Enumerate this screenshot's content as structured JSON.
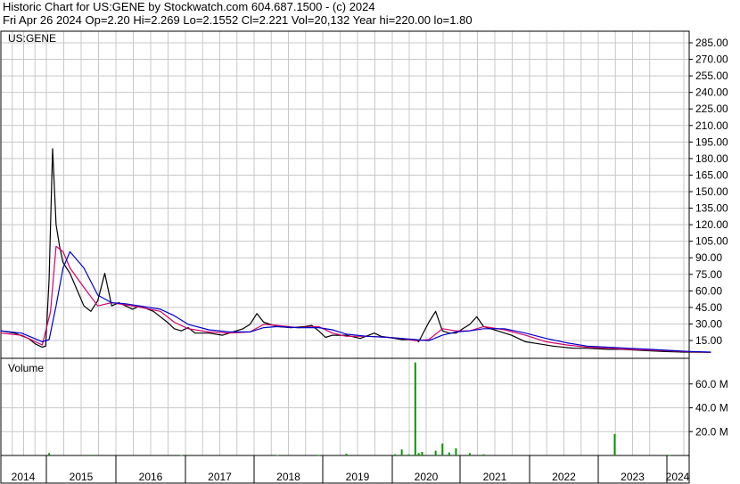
{
  "header": {
    "title": "Historic Chart for US:GENE by Stockwatch.com 604.687.1500 - (c) 2024",
    "quote": "Fri Apr 26 2024   Op=2.20   Hi=2.269   Lo=2.1552   Cl=2.221   Vol=20,132   Year hi=220.00   lo=1.80"
  },
  "chart_data": {
    "type": "line",
    "symbol_label": "US:GENE",
    "volume_label": "Volume",
    "years": [
      "2014",
      "2015",
      "2016",
      "2017",
      "2018",
      "2019",
      "2020",
      "2021",
      "2022",
      "2023",
      "2024"
    ],
    "price_ticks": [
      "285.00",
      "270.00",
      "255.00",
      "240.00",
      "225.00",
      "210.00",
      "195.00",
      "180.00",
      "165.00",
      "150.00",
      "135.00",
      "120.00",
      "105.00",
      "90.00",
      "75.00",
      "60.00",
      "45.00",
      "30.00",
      "15.00"
    ],
    "volume_ticks": [
      "60.0 M",
      "40.0 M",
      "20.0 M"
    ],
    "price_ylim": [
      0,
      295
    ],
    "volume_ylim": [
      0,
      80
    ],
    "colors": {
      "price": "#000000",
      "ma_short": "#d4006a",
      "ma_long": "#0000cc",
      "volume": "#009900",
      "grid": "#c8c8c8"
    },
    "series": [
      {
        "x": [
          2014.0,
          2014.2,
          2014.4,
          2014.5,
          2014.6,
          2014.65,
          2014.7,
          2014.72,
          2014.75,
          2014.8,
          2014.85,
          2014.9,
          2015.0,
          2015.1,
          2015.2,
          2015.3,
          2015.4,
          2015.5,
          2015.6,
          2015.7,
          2015.8,
          2015.9,
          2016.0,
          2016.2,
          2016.4,
          2016.5,
          2016.6,
          2016.7,
          2016.8,
          2017.0,
          2017.2,
          2017.4,
          2017.5,
          2017.6,
          2017.7,
          2017.8,
          2018.0,
          2018.2,
          2018.4,
          2018.5,
          2018.6,
          2018.7,
          2018.8,
          2019.0,
          2019.2,
          2019.4,
          2019.5,
          2019.6,
          2019.7,
          2019.8,
          2020.0,
          2020.05,
          2020.1,
          2020.2,
          2020.3,
          2020.4,
          2020.5,
          2020.6,
          2020.7,
          2020.8,
          2020.9,
          2021.0,
          2021.2,
          2021.4,
          2021.6,
          2021.8,
          2022.0,
          2022.3,
          2022.5,
          2022.8,
          2023.0,
          2023.3,
          2023.6,
          2023.9,
          2024.1,
          2024.3
        ],
        "y": [
          22,
          20,
          15,
          10,
          7,
          8,
          70,
          120,
          190,
          120,
          100,
          85,
          75,
          60,
          45,
          40,
          50,
          75,
          45,
          48,
          45,
          42,
          45,
          40,
          30,
          24,
          22,
          25,
          20,
          20,
          18,
          22,
          24,
          28,
          38,
          30,
          26,
          25,
          26,
          27,
          22,
          16,
          18,
          18,
          15,
          20,
          17,
          16,
          15,
          14,
          14,
          12,
          18,
          30,
          40,
          22,
          20,
          20,
          24,
          28,
          35,
          26,
          22,
          18,
          12,
          10,
          8,
          6,
          6,
          5,
          5,
          4,
          3,
          2.5,
          2.3,
          2.2
        ],
        "name": ""
      },
      {
        "x": [
          2014.0,
          2014.3,
          2014.6,
          2014.72,
          2014.8,
          2014.9,
          2015.0,
          2015.2,
          2015.4,
          2015.6,
          2015.8,
          2016.0,
          2016.3,
          2016.5,
          2016.7,
          2017.0,
          2017.3,
          2017.6,
          2017.8,
          2018.0,
          2018.3,
          2018.6,
          2018.8,
          2019.0,
          2019.3,
          2019.6,
          2019.8,
          2020.0,
          2020.2,
          2020.4,
          2020.6,
          2020.8,
          2021.0,
          2021.3,
          2021.6,
          2021.9,
          2022.2,
          2022.5,
          2022.8,
          2023.1,
          2023.4,
          2023.7,
          2024.0,
          2024.3
        ],
        "y": [
          20,
          18,
          9,
          40,
          100,
          95,
          80,
          62,
          45,
          48,
          46,
          44,
          40,
          30,
          24,
          21,
          20,
          21,
          28,
          27,
          25,
          26,
          20,
          17,
          17,
          16,
          15,
          13,
          14,
          24,
          22,
          22,
          26,
          23,
          18,
          12,
          9,
          7,
          6,
          5,
          4.3,
          3.5,
          2.8,
          2.3
        ],
        "name": ""
      },
      {
        "x": [
          2014.0,
          2014.3,
          2014.6,
          2014.7,
          2014.8,
          2014.9,
          2015.0,
          2015.2,
          2015.4,
          2015.6,
          2015.8,
          2016.0,
          2016.3,
          2016.5,
          2016.7,
          2017.0,
          2017.3,
          2017.6,
          2017.8,
          2018.0,
          2018.3,
          2018.6,
          2018.8,
          2019.0,
          2019.3,
          2019.6,
          2019.8,
          2020.0,
          2020.2,
          2020.4,
          2020.6,
          2020.8,
          2021.0,
          2021.3,
          2021.6,
          2021.9,
          2022.2,
          2022.5,
          2022.8,
          2023.1,
          2023.4,
          2023.7,
          2024.0,
          2024.3
        ],
        "y": [
          22,
          20,
          12,
          14,
          45,
          80,
          95,
          80,
          55,
          48,
          47,
          45,
          42,
          36,
          28,
          23,
          21,
          21,
          25,
          26,
          25,
          25,
          23,
          19,
          17,
          16,
          15,
          14,
          13,
          18,
          21,
          22,
          24,
          24,
          20,
          15,
          11,
          8,
          7,
          6,
          5,
          4,
          3,
          2.5
        ],
        "name": ""
      },
      {
        "x": [
          2014.7,
          2015.3,
          2016.6,
          2018.0,
          2018.6,
          2019.0,
          2019.7,
          2019.8,
          2019.9,
          2020.0,
          2020.05,
          2020.1,
          2020.3,
          2020.4,
          2020.5,
          2020.6,
          2020.8,
          2021.0,
          2022.9,
          2023.7
        ],
        "y": [
          2,
          0.6,
          0.4,
          0.3,
          0.5,
          1.5,
          1,
          5,
          1,
          78,
          2,
          3,
          4,
          10,
          2.5,
          6,
          2,
          1,
          18,
          0.5
        ],
        "name": ""
      }
    ]
  }
}
